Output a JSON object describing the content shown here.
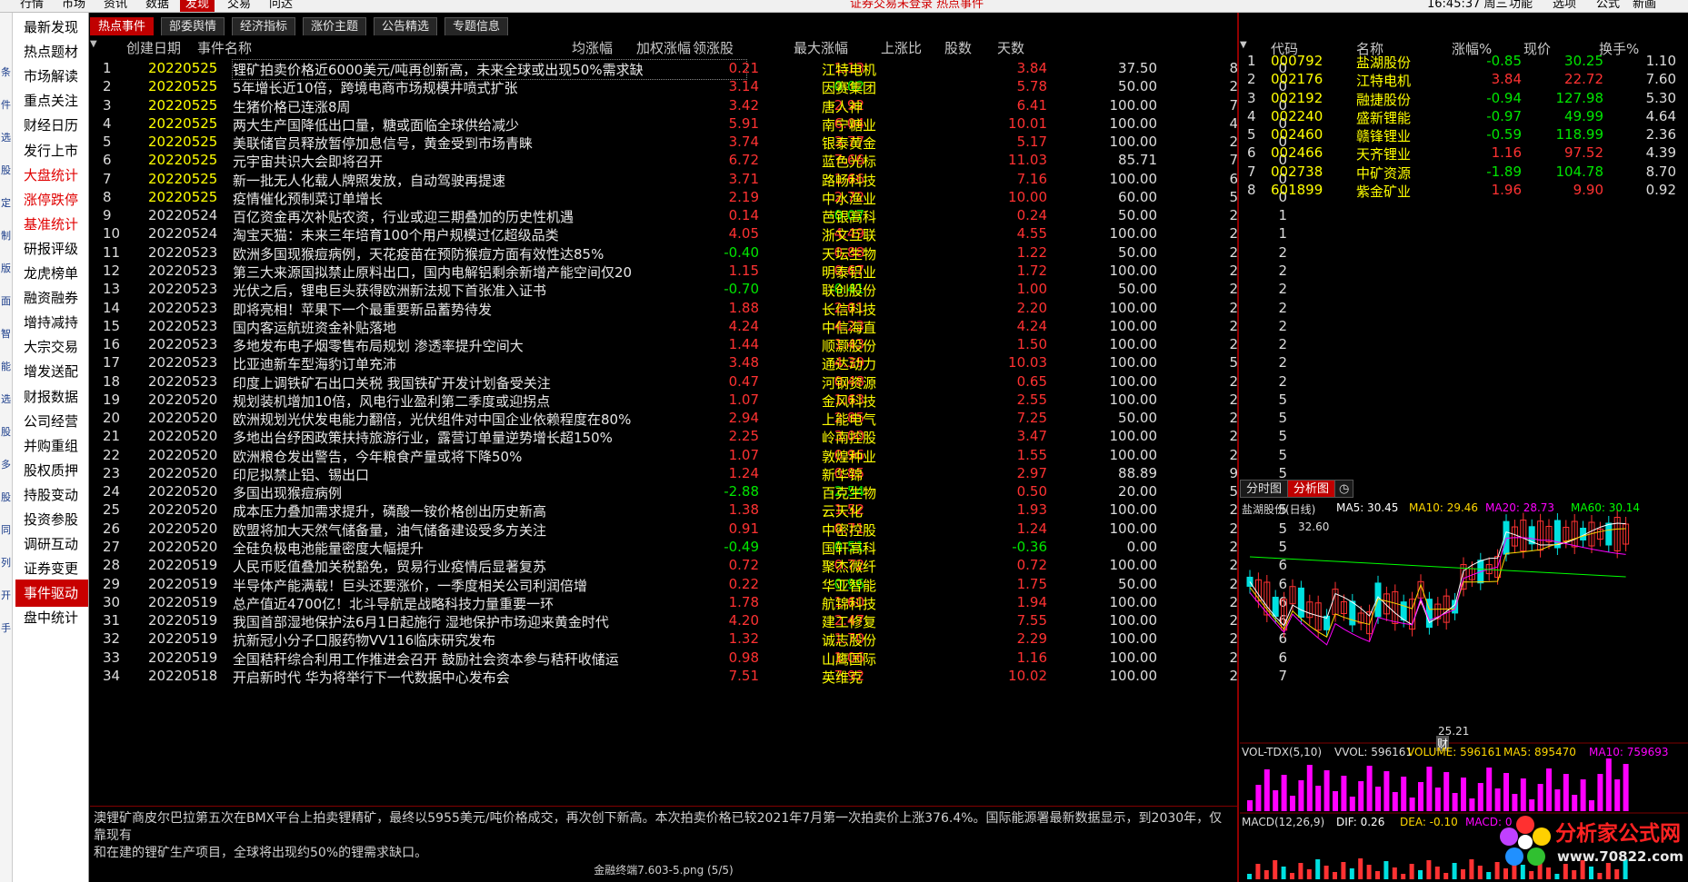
{
  "menu": {
    "items": [
      "行情",
      "市场",
      "资讯",
      "数据",
      "发现",
      "交易",
      "问达"
    ],
    "active": "发现",
    "notice": "证券交易未登录  热点事件",
    "clock": "16:45:37 周三",
    "right_items": [
      "功能",
      "选项",
      "公式",
      "新画"
    ]
  },
  "leftnav": {
    "strip": [
      "条",
      "件",
      "选",
      "股",
      "定",
      "制",
      "版",
      "面",
      "智",
      "能",
      "选",
      "股",
      "多",
      "股",
      "同",
      "列",
      "开",
      "手"
    ],
    "items": [
      "最新发现",
      "热点题材",
      "市场解读",
      "重点关注",
      "财经日历",
      "发行上市",
      "大盘统计",
      "涨停跌停",
      "基准统计",
      "研报评级",
      "龙虎榜单",
      "融资融券",
      "增持减持",
      "大宗交易",
      "增发送配",
      "财报数据",
      "公司经营",
      "并购重组",
      "股权质押",
      "持股变动",
      "投资参股",
      "调研互动",
      "证券变更",
      "事件驱动",
      "盘中统计"
    ],
    "red": [
      "大盘统计",
      "涨停跌停",
      "基准统计"
    ],
    "active": "事件驱动"
  },
  "tabs": [
    "热点事件",
    "部委舆情",
    "经济指标",
    "涨价主题",
    "公告精选",
    "专题信息"
  ],
  "grid": {
    "headers": {
      "date": "创建日期",
      "name": "事件名称",
      "avg": "均涨幅",
      "wgt": "加权涨幅",
      "lead": "领涨股",
      "max": "最大涨幅",
      "ratio": "上涨比",
      "cnt": "股数",
      "days": "天数"
    },
    "rows": [
      {
        "i": "1",
        "date": "20220525",
        "name": "锂矿拍卖价格近6000美元/吨再创新高，未来全球或出现50%需求缺",
        "avg": "0.21",
        "wgt": "1.13",
        "lead": "江特电机",
        "max": "3.84",
        "ratio": "37.50",
        "cnt": "8",
        "days": "0"
      },
      {
        "i": "2",
        "date": "20220525",
        "name": "5年增长近10倍，跨境电商市场规模井喷式扩张",
        "avg": "3.14",
        "wgt": "-0.02",
        "lead": "因赛集团",
        "max": "5.78",
        "ratio": "50.00",
        "cnt": "2",
        "days": "0"
      },
      {
        "i": "3",
        "date": "20220525",
        "name": "生猪价格已连涨8周",
        "avg": "3.42",
        "wgt": "2.92",
        "lead": "唐人神",
        "max": "6.41",
        "ratio": "100.00",
        "cnt": "7",
        "days": "0"
      },
      {
        "i": "4",
        "date": "20220525",
        "name": "两大生产国降低出口量，糖或面临全球供给减少",
        "avg": "5.91",
        "wgt": "6.04",
        "lead": "南宁糖业",
        "max": "10.01",
        "ratio": "100.00",
        "cnt": "4",
        "days": "0"
      },
      {
        "i": "5",
        "date": "20220525",
        "name": "美联储官员释放暂停加息信号，黄金受到市场青睐",
        "avg": "3.74",
        "wgt": "3.77",
        "lead": "银泰黄金",
        "max": "5.17",
        "ratio": "100.00",
        "cnt": "2",
        "days": "0"
      },
      {
        "i": "6",
        "date": "20220525",
        "name": "元宇宙共识大会即将召开",
        "avg": "6.72",
        "wgt": "7.66",
        "lead": "蓝色光标",
        "max": "11.03",
        "ratio": "85.71",
        "cnt": "7",
        "days": "0"
      },
      {
        "i": "7",
        "date": "20220525",
        "name": "新一批无人化载人牌照发放，自动驾驶再提速",
        "avg": "3.71",
        "wgt": "1.66",
        "lead": "路畅科技",
        "max": "7.16",
        "ratio": "100.00",
        "cnt": "6",
        "days": "0"
      },
      {
        "i": "8",
        "date": "20220525",
        "name": "疫情催化预制菜订单增长",
        "avg": "2.19",
        "wgt": "2.72",
        "lead": "中水渔业",
        "max": "10.00",
        "ratio": "60.00",
        "cnt": "5",
        "days": "0"
      },
      {
        "i": "9",
        "date": "20220524",
        "name": "百亿资金再次补贴农资，行业或迎三期叠加的历史性机遇",
        "avg": "0.14",
        "wgt": "-0.07",
        "lead": "芭银高科",
        "max": "0.24",
        "ratio": "50.00",
        "cnt": "2",
        "days": "1"
      },
      {
        "i": "10",
        "date": "20220524",
        "name": "淘宝天猫：未来三年培育100个用户规模过亿超级品类",
        "avg": "4.05",
        "wgt": "4.49",
        "lead": "浙文互联",
        "max": "4.55",
        "ratio": "100.00",
        "cnt": "2",
        "days": "1"
      },
      {
        "i": "11",
        "date": "20220523",
        "name": "欧洲多国现猴痘病例，天花疫苗在预防猴痘方面有效性达85%",
        "avg": "-0.40",
        "wgt": "0.88",
        "lead": "天坛生物",
        "max": "1.22",
        "ratio": "50.00",
        "cnt": "2",
        "days": "2"
      },
      {
        "i": "12",
        "date": "20220523",
        "name": "第三大来源国拟禁止原料出口，国内电解铝剩余新增产能空间仅20",
        "avg": "1.15",
        "wgt": "0.67",
        "lead": "明泰铝业",
        "max": "1.72",
        "ratio": "100.00",
        "cnt": "2",
        "days": "2"
      },
      {
        "i": "13",
        "date": "20220523",
        "name": "光伏之后，锂电巨头获得欧洲新法规下首张准入证书",
        "avg": "-0.70",
        "wgt": "-0.41",
        "lead": "联创股份",
        "max": "1.00",
        "ratio": "50.00",
        "cnt": "2",
        "days": "2"
      },
      {
        "i": "14",
        "date": "20220523",
        "name": "即将亮相！苹果下一个最重要新品蓄势待发",
        "avg": "1.88",
        "wgt": "2.01",
        "lead": "长信科技",
        "max": "2.20",
        "ratio": "100.00",
        "cnt": "2",
        "days": "2"
      },
      {
        "i": "15",
        "date": "20220523",
        "name": "国内客运航班资金补贴落地",
        "avg": "4.24",
        "wgt": "4.23",
        "lead": "中信海直",
        "max": "4.24",
        "ratio": "100.00",
        "cnt": "2",
        "days": "2"
      },
      {
        "i": "16",
        "date": "20220523",
        "name": "多地发布电子烟零售布局规划 渗透率提升空间大",
        "avg": "1.44",
        "wgt": "1.43",
        "lead": "顺灏股份",
        "max": "1.50",
        "ratio": "100.00",
        "cnt": "2",
        "days": "2"
      },
      {
        "i": "17",
        "date": "20220523",
        "name": "比亚迪新车型海豹订单充沛",
        "avg": "3.48",
        "wgt": "4.39",
        "lead": "通达动力",
        "max": "10.03",
        "ratio": "100.00",
        "cnt": "5",
        "days": "2"
      },
      {
        "i": "18",
        "date": "20220523",
        "name": "印度上调铁矿石出口关税 我国铁矿开发计划备受关注",
        "avg": "0.47",
        "wgt": "0.48",
        "lead": "河钢资源",
        "max": "0.65",
        "ratio": "100.00",
        "cnt": "2",
        "days": "2"
      },
      {
        "i": "19",
        "date": "20220520",
        "name": "规划装机增加10倍，风电行业盈利第二季度或迎拐点",
        "avg": "1.07",
        "wgt": "1.63",
        "lead": "金风科技",
        "max": "2.55",
        "ratio": "100.00",
        "cnt": "2",
        "days": "5"
      },
      {
        "i": "20",
        "date": "20220520",
        "name": "欧洲规划光伏发电能力翻倍，光伏组件对中国企业依赖程度在80%",
        "avg": "2.94",
        "wgt": "2.85",
        "lead": "上能电气",
        "max": "7.25",
        "ratio": "50.00",
        "cnt": "2",
        "days": "5"
      },
      {
        "i": "21",
        "date": "20220520",
        "name": "多地出台纾困政策扶持旅游行业，露营订单量逆势增长超150%",
        "avg": "2.25",
        "wgt": "3.00",
        "lead": "岭南控股",
        "max": "3.47",
        "ratio": "100.00",
        "cnt": "2",
        "days": "5"
      },
      {
        "i": "22",
        "date": "20220520",
        "name": "欧洲粮仓发出警告，今年粮食产量或将下降50%",
        "avg": "1.07",
        "wgt": "0.96",
        "lead": "敦煌种业",
        "max": "1.55",
        "ratio": "100.00",
        "cnt": "2",
        "days": "5"
      },
      {
        "i": "23",
        "date": "20220520",
        "name": "印尼拟禁止铝、锡出口",
        "avg": "1.24",
        "wgt": "0.85",
        "lead": "新华锦",
        "max": "2.97",
        "ratio": "88.89",
        "cnt": "9",
        "days": "5"
      },
      {
        "i": "24",
        "date": "20220520",
        "name": "多国出现猴痘病例",
        "avg": "-2.88",
        "wgt": "-2.54",
        "lead": "百克生物",
        "max": "0.50",
        "ratio": "20.00",
        "cnt": "5",
        "days": "5"
      },
      {
        "i": "25",
        "date": "20220520",
        "name": "成本压力叠加需求提升，磷酸一铵价格创出历史新高",
        "avg": "1.38",
        "wgt": "1.52",
        "lead": "云天化",
        "max": "1.93",
        "ratio": "100.00",
        "cnt": "2",
        "days": "5"
      },
      {
        "i": "26",
        "date": "20220520",
        "name": "欧盟将加大天然气储备量，油气储备建设受多方关注",
        "avg": "0.91",
        "wgt": "0.71",
        "lead": "中密控股",
        "max": "1.24",
        "ratio": "100.00",
        "cnt": "2",
        "days": "5"
      },
      {
        "i": "27",
        "date": "20220520",
        "name": "全硅负极电池能量密度大幅提升",
        "avg": "-0.49",
        "wgt": "-0.51",
        "lead": "国轩高科",
        "max": "-0.36",
        "ratio": "0.00",
        "cnt": "2",
        "days": "5"
      },
      {
        "i": "28",
        "date": "20220519",
        "name": "人民币贬值叠加关税豁免，贸易行业疫情后显著复苏",
        "avg": "0.72",
        "wgt": "0.72",
        "lead": "聚杰微纤",
        "max": "0.72",
        "ratio": "100.00",
        "cnt": "2",
        "days": "6"
      },
      {
        "i": "29",
        "date": "20220519",
        "name": "半导体产能满载！巨头还要涨价，一季度相关公司利润倍增",
        "avg": "0.22",
        "wgt": "-0.96",
        "lead": "华亚智能",
        "max": "1.75",
        "ratio": "50.00",
        "cnt": "2",
        "days": "6"
      },
      {
        "i": "30",
        "date": "20220519",
        "name": "总产值近4700亿！北斗导航是战略科技力量重要一环",
        "avg": "1.78",
        "wgt": "1.60",
        "lead": "航锦科技",
        "max": "1.94",
        "ratio": "100.00",
        "cnt": "2",
        "days": "6"
      },
      {
        "i": "31",
        "date": "20220519",
        "name": "我国首部湿地保护法6月1日起施行 湿地保护市场迎来黄金时代",
        "avg": "4.20",
        "wgt": "2.47",
        "lead": "建工修复",
        "max": "7.55",
        "ratio": "100.00",
        "cnt": "2",
        "days": "6"
      },
      {
        "i": "32",
        "date": "20220519",
        "name": "抗新冠小分子口服药物VV116临床研究发布",
        "avg": "1.32",
        "wgt": "1.70",
        "lead": "诚志股份",
        "max": "2.29",
        "ratio": "100.00",
        "cnt": "2",
        "days": "6"
      },
      {
        "i": "33",
        "date": "20220519",
        "name": "全国秸秆综合利用工作推进会召开 鼓励社会资本参与秸秆收储运",
        "avg": "0.98",
        "wgt": "1.06",
        "lead": "山鹰国际",
        "max": "1.16",
        "ratio": "100.00",
        "cnt": "2",
        "days": "6"
      },
      {
        "i": "34",
        "date": "20220518",
        "name": "开启新时代 华为将举行下一代数据中心发布会",
        "avg": "7.51",
        "wgt": "7.92",
        "lead": "英维克",
        "max": "10.02",
        "ratio": "100.00",
        "cnt": "2",
        "days": "7"
      }
    ]
  },
  "description": {
    "line1": "澳锂矿商皮尔巴拉第五次在BMX平台上拍卖锂精矿，最终以5955美元/吨价格成交，再次创下新高。本次拍卖价格已较2021年7月第一次拍卖价上涨376.4%。国际能源署最新数据显示，到2030年，仅靠现有",
    "line2": "和在建的锂矿生产项目，全球将出现约50%的锂需求缺口。"
  },
  "statusbar": "金融终端7.603-5.png (5/5)",
  "right_list": {
    "headers": {
      "code": "代码",
      "name": "名称",
      "chg": "涨幅%",
      "price": "现价",
      "turn": "换手%"
    },
    "rows": [
      {
        "i": "1",
        "code": "000792",
        "name": "盐湖股份",
        "chg": "-0.85",
        "price": "30.25",
        "turn": "1.10"
      },
      {
        "i": "2",
        "code": "002176",
        "name": "江特电机",
        "chg": "3.84",
        "price": "22.72",
        "turn": "7.60"
      },
      {
        "i": "3",
        "code": "002192",
        "name": "融捷股份",
        "chg": "-0.94",
        "price": "127.98",
        "turn": "5.30"
      },
      {
        "i": "4",
        "code": "002240",
        "name": "盛新锂能",
        "chg": "-0.97",
        "price": "49.99",
        "turn": "4.64"
      },
      {
        "i": "5",
        "code": "002460",
        "name": "赣锋锂业",
        "chg": "-0.59",
        "price": "118.99",
        "turn": "2.36"
      },
      {
        "i": "6",
        "code": "002466",
        "name": "天齐锂业",
        "chg": "1.16",
        "price": "97.52",
        "turn": "4.39"
      },
      {
        "i": "7",
        "code": "002738",
        "name": "中矿资源",
        "chg": "-1.89",
        "price": "104.78",
        "turn": "8.70"
      },
      {
        "i": "8",
        "code": "601899",
        "name": "紫金矿业",
        "chg": "1.96",
        "price": "9.90",
        "turn": "0.92"
      }
    ]
  },
  "chart_tabs": [
    "分时图",
    "分析图"
  ],
  "chart": {
    "title": "盐湖股份(日线)",
    "ma5": "MA5: 30.45",
    "ma10": "MA10: 29.46",
    "ma20": "MA20: 28.73",
    "ma60": "MA60: 30.14",
    "high_label": "32.60",
    "low_label": "25.21",
    "cai": "财",
    "vol_title": "VOL-TDX(5,10)",
    "vvol": "VVOL: 596161",
    "volume": "VOLUME: 596161",
    "vma5": "MA5: 895470",
    "vma10": "MA10: 759693",
    "macd_title": "MACD(12,26,9)",
    "dif": "DIF: 0.26",
    "dea": "DEA: -0.10",
    "macd": "MACD: 0",
    "colors": {
      "up": "#ff3232",
      "down": "#00e0e0",
      "ma5": "#ffffff",
      "ma10": "#ffd700",
      "ma20": "#ff00ff",
      "ma60": "#00ff00"
    }
  },
  "logo": {
    "name": "分析家公式网",
    "url": "www.70822.com"
  }
}
